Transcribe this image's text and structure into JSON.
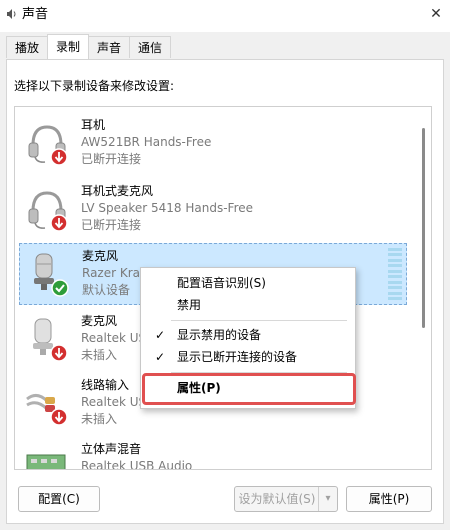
{
  "window": {
    "title": "声音",
    "close_glyph": "✕",
    "tabs": [
      {
        "label": "播放"
      },
      {
        "label": "录制"
      },
      {
        "label": "声音"
      },
      {
        "label": "通信"
      }
    ]
  },
  "main": {
    "instruction": "选择以下录制设备来修改设置:",
    "devices": [
      {
        "name": "耳机",
        "desc": "AW521BR Hands-Free",
        "status": "已断开连接",
        "icon": "headset-icon",
        "badge": "disconnected-badge"
      },
      {
        "name": "耳机式麦克风",
        "desc": "LV Speaker 5418 Hands-Free",
        "status": "已断开连接",
        "icon": "headset-icon",
        "badge": "disconnected-badge"
      },
      {
        "name": "麦克风",
        "desc": "Razer Kra",
        "status": "默认设备",
        "icon": "microphone-icon",
        "badge": "default-check-badge"
      },
      {
        "name": "麦克风",
        "desc": "Realtek US",
        "status": "未插入",
        "icon": "microphone-icon",
        "badge": "unplugged-badge"
      },
      {
        "name": "线路输入",
        "desc": "Realtek US",
        "status": "未插入",
        "icon": "line-in-icon",
        "badge": "unplugged-badge"
      },
      {
        "name": "立体声混音",
        "desc": "Realtek USB Audio",
        "status": "",
        "icon": "stereo-mix-icon",
        "badge": ""
      }
    ]
  },
  "context_menu": {
    "items": [
      {
        "label": "配置语音识别(S)",
        "checked": ""
      },
      {
        "label": "禁用",
        "checked": ""
      },
      {
        "label": "显示禁用的设备",
        "checked": "✓"
      },
      {
        "label": "显示已断开连接的设备",
        "checked": "✓"
      },
      {
        "label": "属性(P)",
        "checked": ""
      }
    ]
  },
  "buttons": {
    "configure": "配置(C)",
    "set_default": "设为默认值(S)",
    "set_default_arrow": "▾",
    "properties": "属性(P)"
  },
  "colors": {
    "selection": "#cce8ff",
    "highlight": "#e05050",
    "status_red": "#d32f2f",
    "status_green": "#2e9d3a"
  }
}
